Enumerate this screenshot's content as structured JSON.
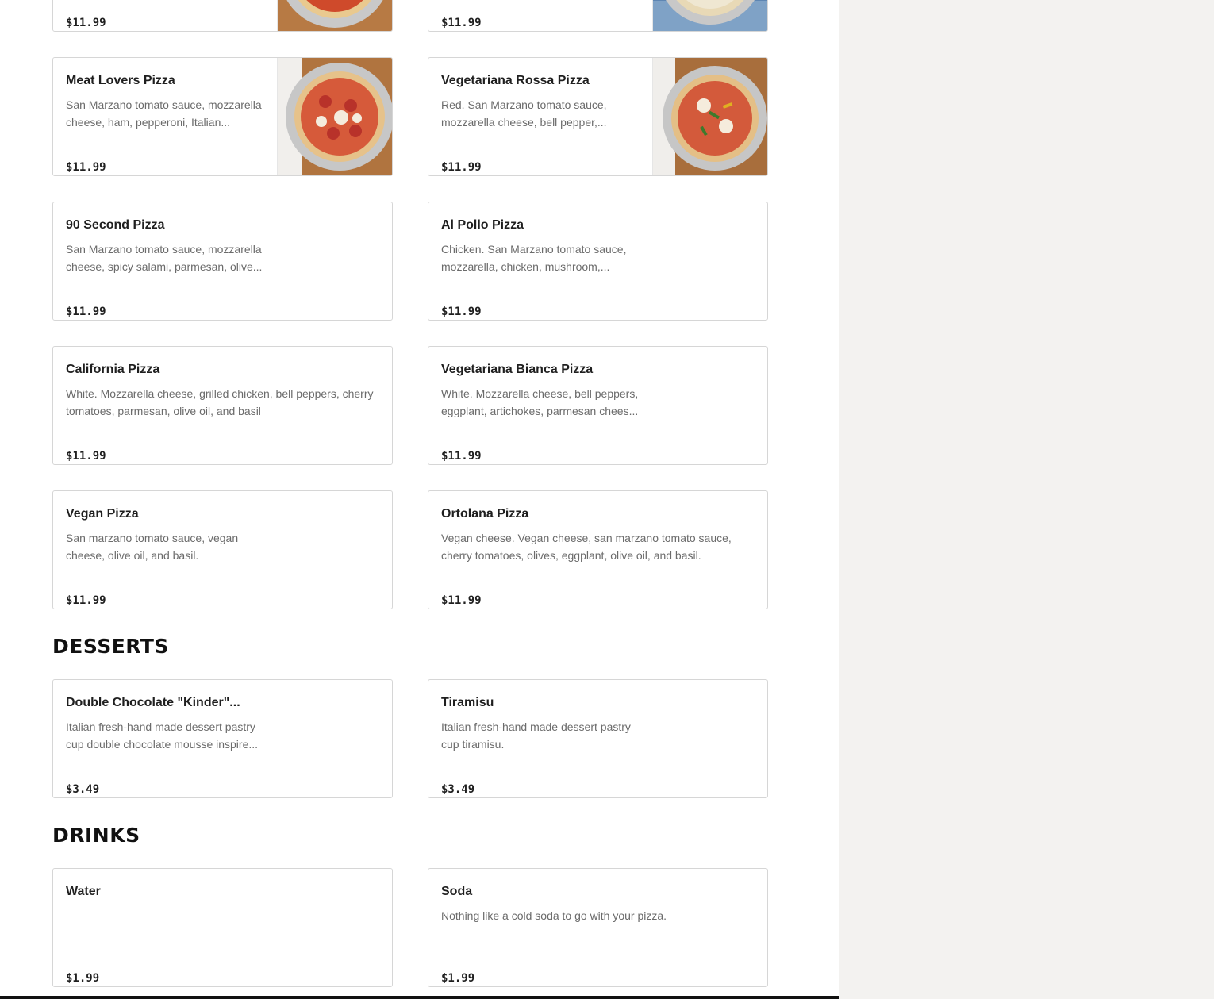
{
  "pizzas_top_partial": [
    {
      "price": "$11.99"
    },
    {
      "price": "$11.99"
    }
  ],
  "pizzas": [
    {
      "name": "Meat Lovers Pizza",
      "description": "San Marzano tomato sauce, mozzarella cheese, ham, pepperoni, Italian...",
      "price": "$11.99"
    },
    {
      "name": "Vegetariana Rossa Pizza",
      "description": "Red. San Marzano tomato sauce, mozzarella cheese, bell pepper,...",
      "price": "$11.99"
    },
    {
      "name": "90 Second Pizza",
      "description": "San Marzano tomato sauce, mozzarella cheese, spicy salami, parmesan, olive...",
      "price": "$11.99"
    },
    {
      "name": "Al Pollo Pizza",
      "description": "Chicken. San Marzano tomato sauce, mozzarella, chicken, mushroom,...",
      "price": "$11.99"
    },
    {
      "name": "California Pizza",
      "description": "White. Mozzarella cheese, grilled chicken, bell peppers, cherry tomatoes, parmesan, olive oil, and basil",
      "price": "$11.99"
    },
    {
      "name": "Vegetariana Bianca Pizza",
      "description": "White. Mozzarella cheese, bell peppers, eggplant, artichokes, parmesan chees...",
      "price": "$11.99"
    },
    {
      "name": "Vegan Pizza",
      "description": "San marzano tomato sauce, vegan cheese, olive oil, and basil.",
      "price": "$11.99"
    },
    {
      "name": "Ortolana Pizza",
      "description": "Vegan cheese. Vegan cheese, san marzano tomato sauce, cherry tomatoes, olives, eggplant, olive oil, and basil.",
      "price": "$11.99"
    }
  ],
  "desserts": {
    "title": "DESSERTS",
    "items": [
      {
        "name": "Double Chocolate \"Kinder\"...",
        "description": "Italian fresh-hand made dessert pastry cup double chocolate mousse inspire...",
        "price": "$3.49"
      },
      {
        "name": "Tiramisu",
        "description": "Italian fresh-hand made dessert pastry cup tiramisu.",
        "price": "$3.49"
      }
    ]
  },
  "drinks": {
    "title": "DRINKS",
    "items": [
      {
        "name": "Water",
        "description": "",
        "price": "$1.99"
      },
      {
        "name": "Soda",
        "description": "Nothing like a cold soda to go with your pizza.",
        "price": "$1.99"
      }
    ]
  }
}
